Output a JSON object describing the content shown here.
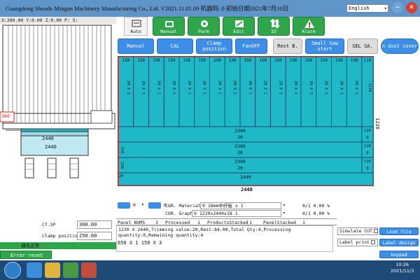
{
  "window": {
    "title": "Guangdong Shunde Mingan Machinery Manufacturing Co., Ltd.  V2021.11.01.09   机器码: 0  初始日期2021年7月10日",
    "language": "English",
    "min_glyph": "−",
    "close_glyph": "✕"
  },
  "coords": "X:280.00  Y:0.00  Z:0.00  P:  S:",
  "toolbar": {
    "auto": "Auto",
    "manual": "Manual",
    "parm": "Parm",
    "edit": "Edit",
    "io": "IO",
    "alarm": "Alarm"
  },
  "row2": {
    "manual": "Manual",
    "cal": "CAL",
    "clamp_position": "Clamp position",
    "fan_off": "FanOFF",
    "rest_b": "Rest B.",
    "small_saw_start": "Small Saw start",
    "sel_sa": "SEL SA.",
    "dust_cover": "n dust cover"
  },
  "layout": {
    "dim_height": "1220",
    "dim_width": "2440",
    "top_strip_labels": [
      "150",
      "150",
      "150",
      "150",
      "150",
      "150",
      "150",
      "150",
      "150",
      "150",
      "150",
      "150",
      "150",
      "150",
      "150",
      "150",
      "110"
    ],
    "strip_side_label": "20 X 1",
    "strip_side_label_last": "1110",
    "rows": [
      {
        "top": "2300",
        "bottom": "20",
        "side_left": "",
        "side_right": "116",
        "side_right2": "0"
      },
      {
        "top": "2300",
        "bottom": "20",
        "side_left": "150",
        "side_right": "116",
        "side_right2": "0"
      },
      {
        "top": "2300",
        "bottom": "20",
        "side_left": "150",
        "side_right": "116",
        "side_right2": "0"
      }
    ],
    "bottom_row": "2440",
    "bottom_row_left": "20"
  },
  "machine": {
    "label_top": "2440",
    "label_bottom": "2440",
    "side_label": "360"
  },
  "controls": {
    "sel1_value": "0",
    "sel2_value": "0",
    "material_label": "CUR. Material",
    "material_value": "0  18mm中纤板 x 1",
    "graph_label": "CUR. Graph",
    "graph_value": "0  1220x2440x18  1",
    "progress1": "0/1  0.00 %",
    "progress2": "0/1  0.00 %"
  },
  "left_status": {
    "ct_sp_label": "CT.SP",
    "ct_sp_value": "300.00",
    "clamp_label": "Clamp position",
    "clamp_value": "250.00",
    "status_text": "通讯正常"
  },
  "counts": {
    "panel_nums_label": "Panel NUMS",
    "panel_nums": "3",
    "processed_label": "Processed",
    "processed": "1",
    "products_stacked_label": "ProductsStacked",
    "products_stacked": "1",
    "panel_stacked_label": "PanelStacked",
    "panel_stacked": "1"
  },
  "info_text": "1220 X 2440,Trimming value:20,Rest:84.00,Total Qty:4,Processing\nquantity:0,Remaining quantity:4",
  "dims_line": "650 X 1 150 X 3",
  "right_panel": {
    "simulate_cut": "Simulate CUT",
    "label_print": "Label print",
    "load_file": "Load file",
    "label_design": "Label design",
    "keypad": "keypad"
  },
  "error_reset": "Error reset",
  "taskbar": {
    "time": "10:26",
    "date": "2021/11/3"
  },
  "colors": {
    "accent": "#3d8ee6",
    "green": "#2fa64a",
    "panel_fill": "#1fb8c6",
    "border_red": "#d92222"
  }
}
